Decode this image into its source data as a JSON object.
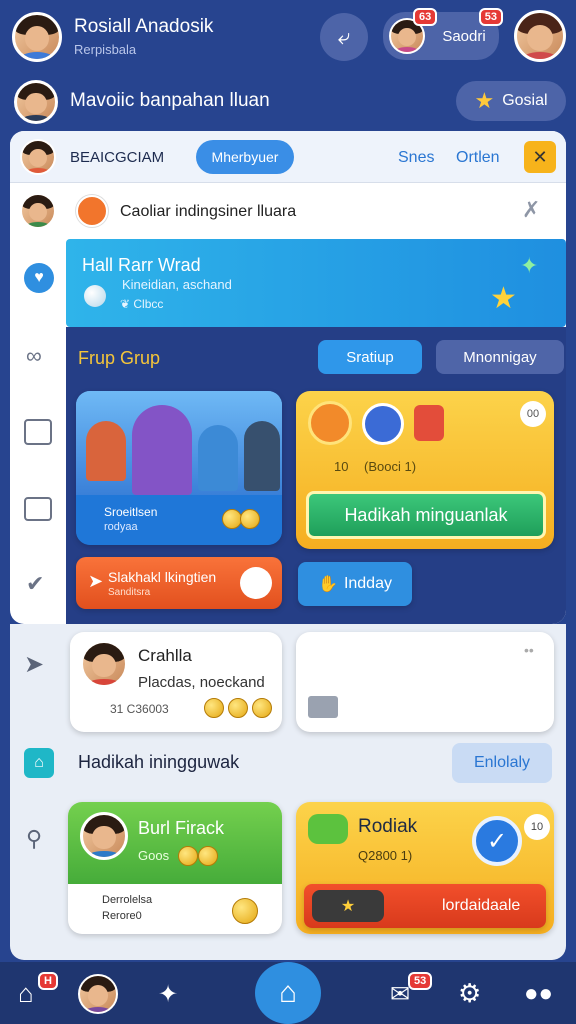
{
  "header": {
    "name": "Rosiall Anadosik",
    "subtitle": "Rerpisbala",
    "notif_left_badge": "63",
    "notif_right_badge": "53",
    "pill_label": "Saodri"
  },
  "banner": {
    "text": "Mavoiic banpahan lluan",
    "button_label": "Gosial"
  },
  "panel": {
    "brand": "BEAICGCIAM",
    "tab_active": "Mherbyuer",
    "link1": "Snes",
    "link2": "Ortlen"
  },
  "notice": {
    "text": "Caoliar indingsiner lluara"
  },
  "hero": {
    "title": "Hall Rarr Wrad",
    "subtitle": "Kineidian, aschand",
    "meta": "❦ Clbcc"
  },
  "group": {
    "title": "Frup Grup",
    "btn1": "Sratiup",
    "btn2": "Mnonnigay"
  },
  "cardA": {
    "line1": "Sroeitlsen",
    "line2": "rodyaa"
  },
  "cardB": {
    "meta1": "10",
    "meta2": "(Booci 1)",
    "cta": "Hadikah minguanlak",
    "corner": "00"
  },
  "orange_btn": {
    "line1": "Slakhakl lkingtien",
    "line2": "Sanditsra"
  },
  "today_btn": "Indday",
  "profile": {
    "name": "Crahlla",
    "subtitle": "Placdas, noeckand",
    "meta": "31  C36003"
  },
  "section": {
    "title": "Hadikah iningguwak",
    "button": "Enlolaly"
  },
  "green_card": {
    "title": "Burl Firack",
    "meta": "Goos",
    "foot1": "Derrolelsa",
    "foot2": "Rerore0"
  },
  "yellow_card": {
    "title": "Rodiak",
    "meta": "Q2800 1)",
    "corner": "10",
    "btn": "lordaidaale"
  },
  "nav": {
    "home_badge": "H",
    "msg_badge": "53"
  },
  "colors": {
    "accent": "#2f8fe0",
    "header_bg": "#27448f",
    "green": "#4caf50",
    "orange": "#f47b20",
    "yellow": "#f8c435"
  }
}
